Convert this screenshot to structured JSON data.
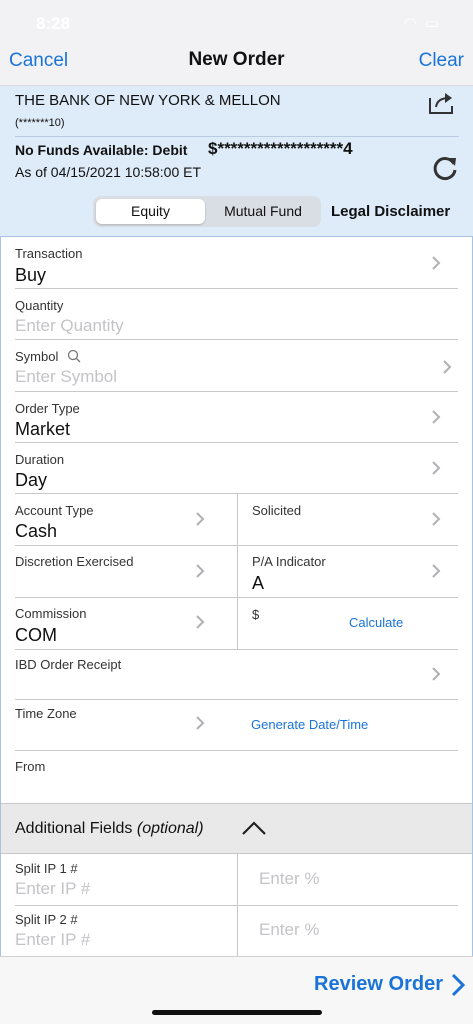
{
  "status": {
    "time": "8:28",
    "icons": "wifi battery"
  },
  "nav": {
    "cancel": "Cancel",
    "title": "New Order",
    "clear": "Clear"
  },
  "account": {
    "name": "THE BANK OF NEW YORK & MELLON",
    "number": "(*******10)",
    "funds_label": "No Funds Available: Debit",
    "funds_value": "$*******************4",
    "as_of": "As of 04/15/2021 10:58:00 ET"
  },
  "tabs": {
    "equity": "Equity",
    "mutual_fund": "Mutual Fund",
    "legal": "Legal Disclaimer"
  },
  "form": {
    "transaction": {
      "label": "Transaction",
      "value": "Buy"
    },
    "quantity": {
      "label": "Quantity",
      "placeholder": "Enter Quantity"
    },
    "symbol": {
      "label": "Symbol",
      "placeholder": "Enter Symbol"
    },
    "order_type": {
      "label": "Order Type",
      "value": "Market"
    },
    "duration": {
      "label": "Duration",
      "value": "Day"
    },
    "account_type": {
      "label": "Account Type",
      "value": "Cash"
    },
    "solicited": {
      "label": "Solicited",
      "value": ""
    },
    "discretion": {
      "label": "Discretion Exercised",
      "value": ""
    },
    "pa_indicator": {
      "label": "P/A Indicator",
      "value": "A"
    },
    "commission": {
      "label": "Commission",
      "value": "COM"
    },
    "dollar": {
      "label": "$",
      "action": "Calculate"
    },
    "ibd": {
      "label": "IBD Order Receipt"
    },
    "time_zone": {
      "label": "Time Zone",
      "action": "Generate Date/Time"
    },
    "from": {
      "label": "From"
    }
  },
  "additional": {
    "label": "Additional Fields",
    "optional": "(optional)",
    "split1": {
      "label": "Split IP 1 #",
      "ip_placeholder": "Enter IP #",
      "pct_placeholder": "Enter %"
    },
    "split2": {
      "label": "Split IP 2 #",
      "ip_placeholder": "Enter IP #",
      "pct_placeholder": "Enter %"
    }
  },
  "footer": {
    "review": "Review Order"
  },
  "colors": {
    "accent": "#1a74d8",
    "header_bg": "#deebf8"
  }
}
